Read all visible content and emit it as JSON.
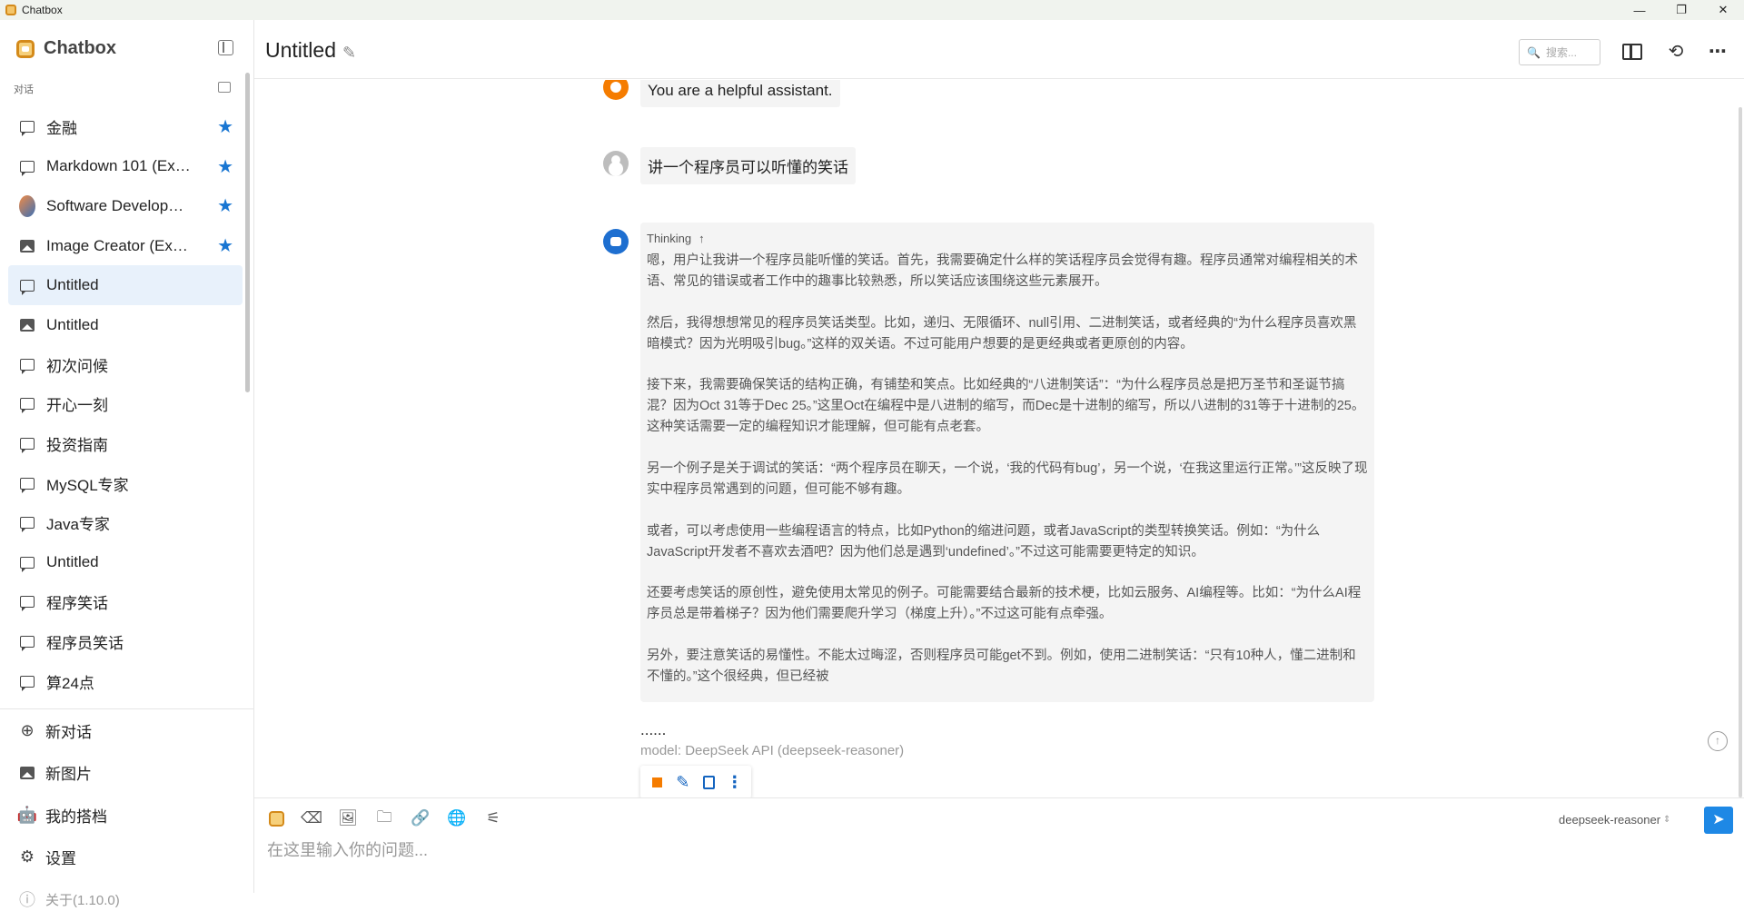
{
  "window": {
    "title": "Chatbox",
    "controls": [
      "—",
      "❐",
      "✕"
    ]
  },
  "sidebar": {
    "brand": "Chatbox",
    "section_label": "对话",
    "sessions": [
      {
        "label": "金融",
        "icon": "chat-icon",
        "starred": true,
        "star": "★"
      },
      {
        "label": "Markdown 101 (Ex…",
        "icon": "chat-icon",
        "starred": true,
        "star": "★"
      },
      {
        "label": "Software Develop…",
        "icon": "avatar-icon",
        "starred": true,
        "star": "★"
      },
      {
        "label": "Image Creator (Ex…",
        "icon": "image-icon",
        "starred": true,
        "star": "★"
      },
      {
        "label": "Untitled",
        "icon": "chat-icon",
        "active": true
      },
      {
        "label": "Untitled",
        "icon": "image-icon"
      },
      {
        "label": "初次问候",
        "icon": "chat-icon"
      },
      {
        "label": "开心一刻",
        "icon": "chat-icon"
      },
      {
        "label": "投资指南",
        "icon": "chat-icon"
      },
      {
        "label": "MySQL专家",
        "icon": "chat-icon"
      },
      {
        "label": "Java专家",
        "icon": "chat-icon"
      },
      {
        "label": "Untitled",
        "icon": "chat-icon"
      },
      {
        "label": "程序笑话",
        "icon": "chat-icon"
      },
      {
        "label": "程序员笑话",
        "icon": "chat-icon"
      },
      {
        "label": "算24点",
        "icon": "chat-icon"
      }
    ],
    "menu": {
      "new_chat": "新对话",
      "new_image": "新图片",
      "my_copilots": "我的搭档",
      "settings": "设置",
      "about": "关于(1.10.0)"
    }
  },
  "header": {
    "title": "Untitled",
    "search_placeholder": "搜索..."
  },
  "messages": {
    "system": "You are a helpful assistant.",
    "user": "讲一个程序员可以听懂的笑话",
    "thinking_label": "Thinking",
    "thinking_paragraphs": [
      "嗯，用户让我讲一个程序员能听懂的笑话。首先，我需要确定什么样的笑话程序员会觉得有趣。程序员通常对编程相关的术语、常见的错误或者工作中的趣事比较熟悉，所以笑话应该围绕这些元素展开。",
      "然后，我得想想常见的程序员笑话类型。比如，递归、无限循环、null引用、二进制笑话，或者经典的“为什么程序员喜欢黑暗模式？因为光明吸引bug。”这样的双关语。不过可能用户想要的是更经典或者更原创的内容。",
      "接下来，我需要确保笑话的结构正确，有铺垫和笑点。比如经典的“八进制笑话”：“为什么程序员总是把万圣节和圣诞节搞混？因为Oct 31等于Dec 25。”这里Oct在编程中是八进制的缩写，而Dec是十进制的缩写，所以八进制的31等于十进制的25。这种笑话需要一定的编程知识才能理解，但可能有点老套。",
      "另一个例子是关于调试的笑话：“两个程序员在聊天，一个说，‘我的代码有bug’，另一个说，‘在我这里运行正常。’”这反映了现实中程序员常遇到的问题，但可能不够有趣。",
      "或者，可以考虑使用一些编程语言的特点，比如Python的缩进问题，或者JavaScript的类型转换笑话。例如：“为什么JavaScript开发者不喜欢去酒吧？因为他们总是遇到‘undefined’。”不过这可能需要更特定的知识。",
      "还要考虑笑话的原创性，避免使用太常见的例子。可能需要结合最新的技术梗，比如云服务、AI编程等。比如：“为什么AI程序员总是带着梯子？因为他们需要爬升学习（梯度上升）。”不过这可能有点牵强。",
      "另外，要注意笑话的易懂性。不能太过晦涩，否则程序员可能get不到。例如，使用二进制笑话：“只有10种人，懂二进制和不懂的。”这个很经典，但已经被"
    ],
    "ellipsis": "......",
    "model_info": "model: DeepSeek API (deepseek-reasoner)"
  },
  "input": {
    "placeholder": "在这里输入你的问题...",
    "model": "deepseek-reasoner"
  },
  "colors": {
    "accent": "#1e88e5",
    "star": "#1976d2",
    "active_bg": "#e8f1fb",
    "stop": "#f57c00"
  }
}
